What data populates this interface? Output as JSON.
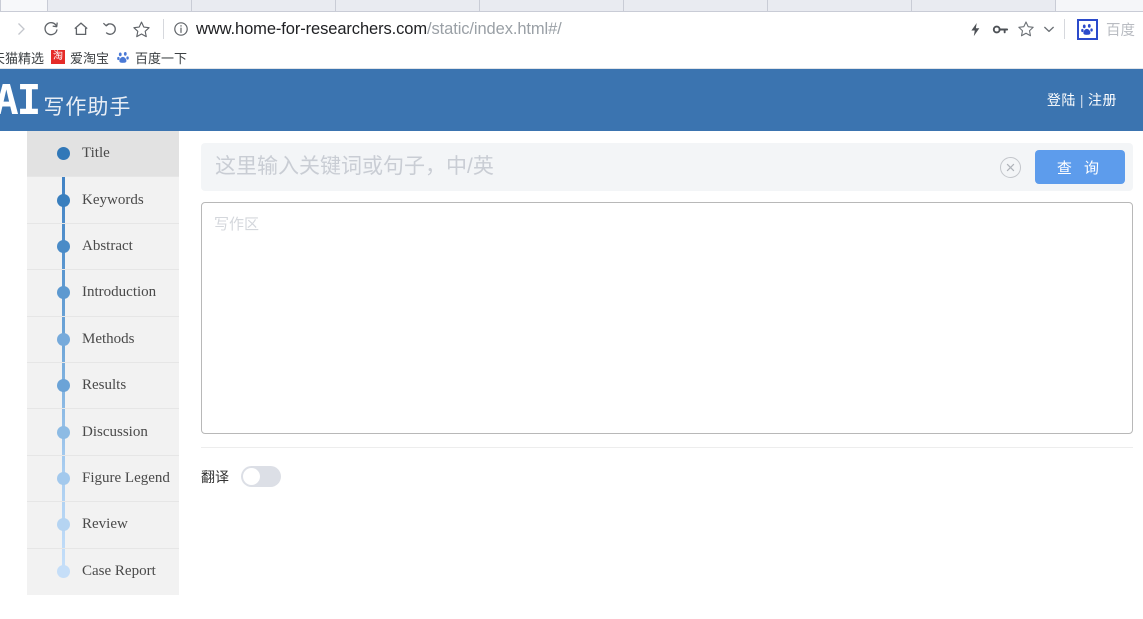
{
  "browser": {
    "nav_icons": [
      {
        "name": "forward-icon",
        "glyph": "›",
        "disabled": true
      },
      {
        "name": "reload-icon",
        "glyph": "↻",
        "disabled": false
      },
      {
        "name": "home-icon",
        "glyph": "⌂",
        "disabled": false
      },
      {
        "name": "history-back-icon",
        "glyph": "↶",
        "disabled": false
      },
      {
        "name": "bookmark-star-icon",
        "glyph": "☆",
        "disabled": false
      }
    ],
    "url": {
      "info_icon": "ⓘ",
      "domain": "www.home-for-researchers.com",
      "path": "/static/index.html#/"
    },
    "toolbar_right": {
      "lightning_icon": "⚡",
      "key_icon": "⚷",
      "star_icon": "☆",
      "chevron_icon": "⌄",
      "extension_label": "百度"
    },
    "bookmarks": [
      {
        "label": "天猫精选",
        "icon": "none"
      },
      {
        "label": "爱淘宝",
        "icon": "taobao-icon",
        "icon_char": "淘"
      },
      {
        "label": "百度一下",
        "icon": "baidu-paw-icon"
      }
    ]
  },
  "app": {
    "header": {
      "logo_main": "AI",
      "logo_sub": "写作助手",
      "login_label": "登陆",
      "separator": "|",
      "register_label": "注册",
      "background_color": "#3b74b0"
    },
    "sidebar": {
      "items": [
        {
          "label": "Title",
          "dot_color": "#3178b8",
          "active": true
        },
        {
          "label": "Keywords",
          "dot_color": "#3a7fbe",
          "active": false
        },
        {
          "label": "Abstract",
          "dot_color": "#4a8bc7",
          "active": false
        },
        {
          "label": "Introduction",
          "dot_color": "#5d99d0",
          "active": false
        },
        {
          "label": "Methods",
          "dot_color": "#76aadb",
          "active": false
        },
        {
          "label": "Results",
          "dot_color": "#6ba3d7",
          "active": false
        },
        {
          "label": "Discussion",
          "dot_color": "#8dbbe4",
          "active": false
        },
        {
          "label": "Figure Legend",
          "dot_color": "#a3c9ed",
          "active": false
        },
        {
          "label": "Review",
          "dot_color": "#b5d4f2",
          "active": false
        },
        {
          "label": "Case Report",
          "dot_color": "#c5def8",
          "active": false
        }
      ]
    },
    "search": {
      "placeholder": "这里输入关键词或句子，中/英",
      "value": "",
      "clear_icon": "✕",
      "button_label": "查 询",
      "button_color": "#5d9cec"
    },
    "editor": {
      "placeholder": "写作区",
      "value": ""
    },
    "translate": {
      "label": "翻译",
      "enabled": false
    }
  }
}
